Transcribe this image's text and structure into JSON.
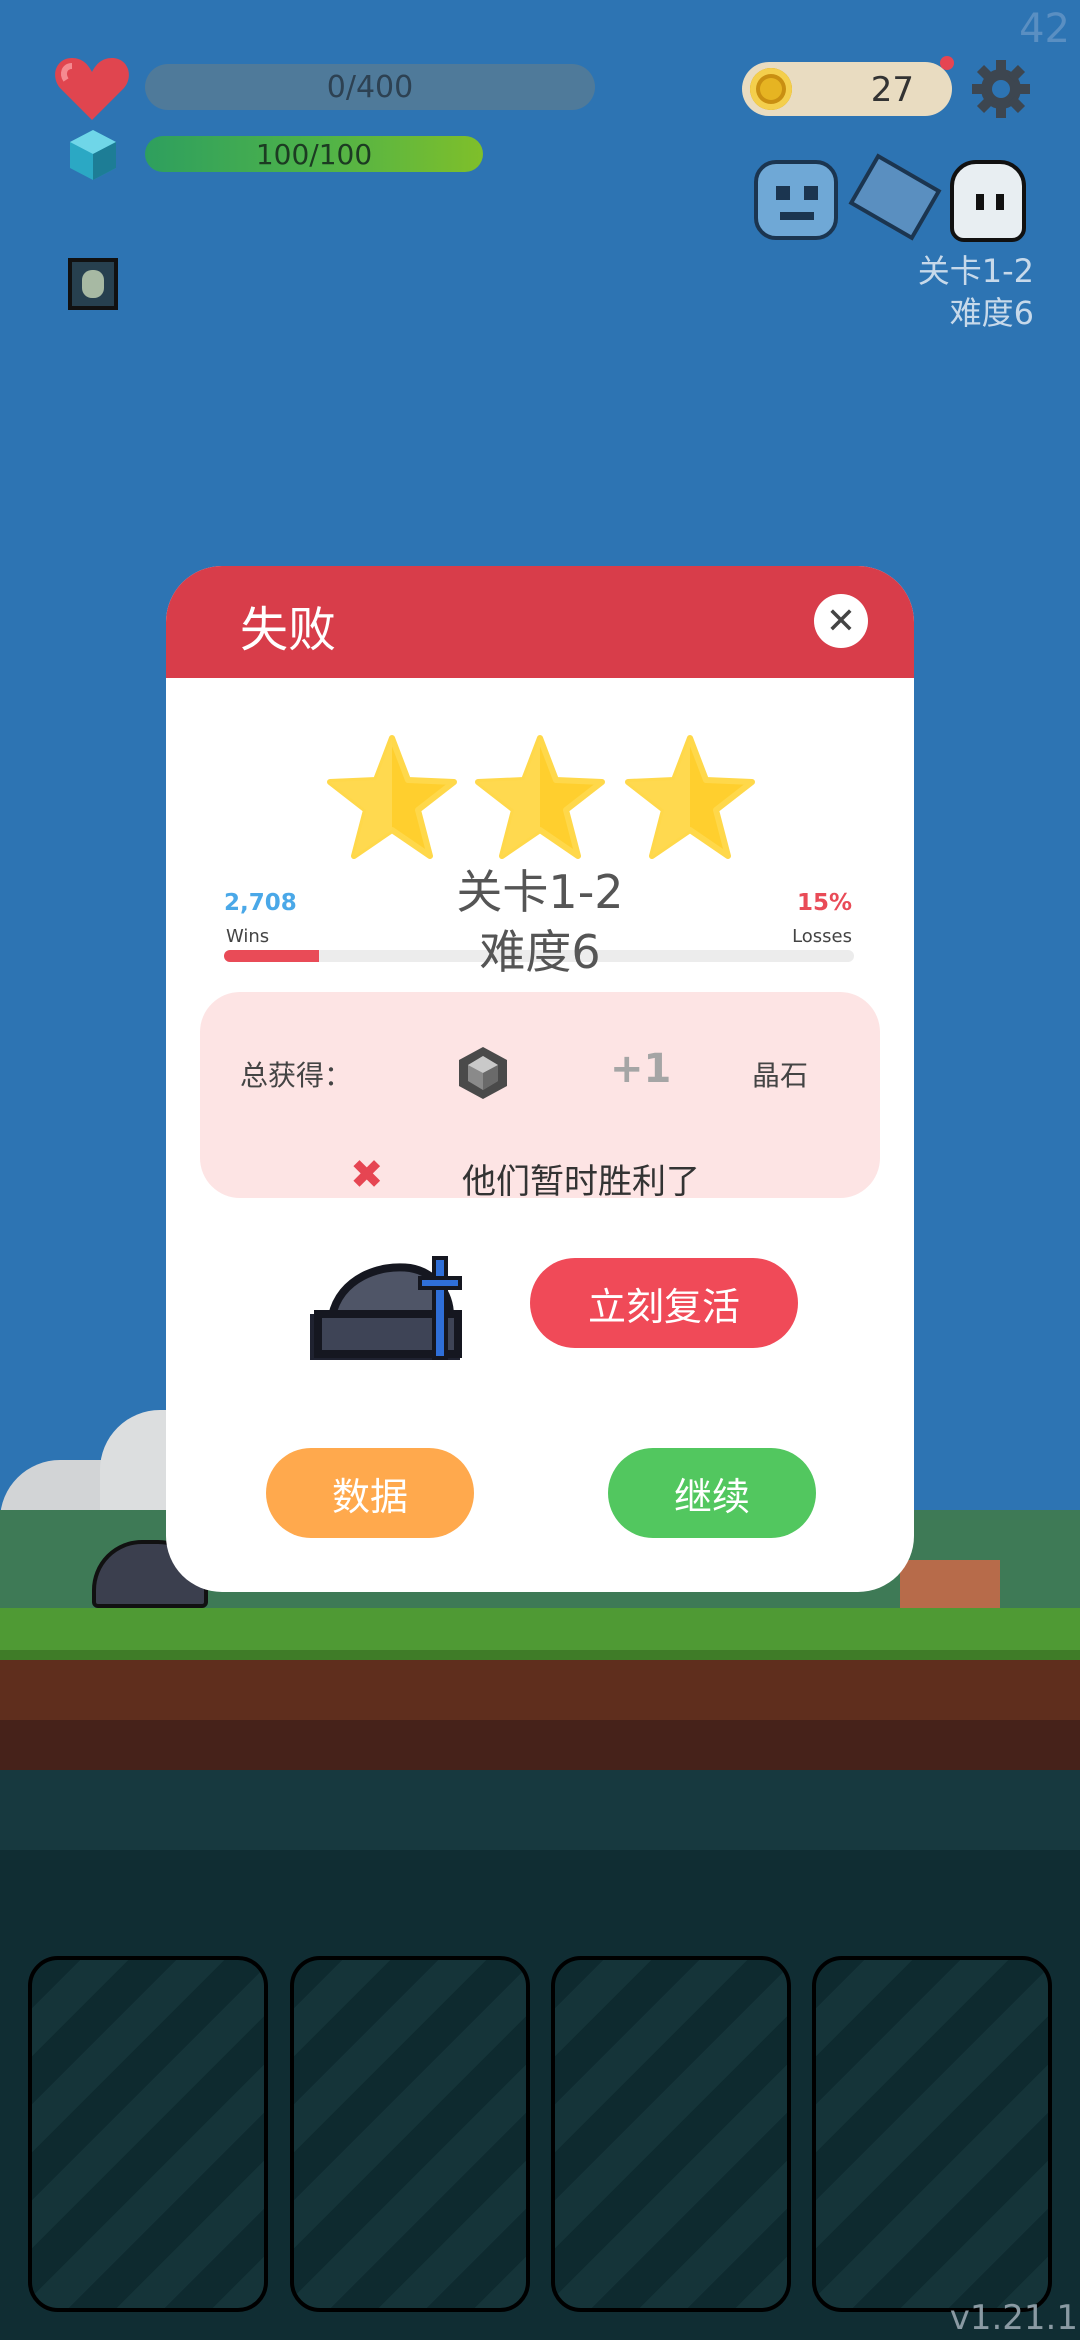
{
  "hud": {
    "fps": "42",
    "hp_text": "0/400",
    "mp_text": "100/100",
    "coins": "27",
    "level_line1": "关卡1-2",
    "level_line2": "难度6"
  },
  "dialog": {
    "title": "失败",
    "stars": 3,
    "level_line1": "关卡1-2",
    "level_line2": "难度6",
    "wins_count": "2,708",
    "wins_label": "Wins",
    "losses_percent": "15%",
    "losses_label": "Losses",
    "losses_fraction": 0.15,
    "reward_label": "总获得：",
    "reward_amount": "+1",
    "reward_name": "晶石",
    "reward_icon": "gem-icon",
    "defeat_message": "他们暂时胜利了",
    "revive_button": "立刻复活",
    "stats_button": "数据",
    "continue_button": "继续"
  },
  "colors": {
    "header_red": "#d83d4a",
    "revive_red": "#f04a58",
    "stats_orange": "#ffa94d",
    "continue_green": "#52c75f",
    "star_yellow": "#ffcf2e"
  },
  "version": "v1.21.1"
}
